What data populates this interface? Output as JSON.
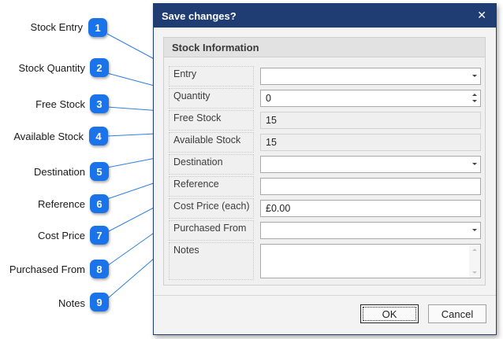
{
  "callouts": [
    {
      "number": "1",
      "label": "Stock Entry"
    },
    {
      "number": "2",
      "label": "Stock Quantity"
    },
    {
      "number": "3",
      "label": "Free Stock"
    },
    {
      "number": "4",
      "label": "Available Stock"
    },
    {
      "number": "5",
      "label": "Destination"
    },
    {
      "number": "6",
      "label": "Reference"
    },
    {
      "number": "7",
      "label": "Cost Price"
    },
    {
      "number": "8",
      "label": "Purchased From"
    },
    {
      "number": "9",
      "label": "Notes"
    }
  ],
  "dialog": {
    "title": "Save changes?",
    "close_icon": "close-icon",
    "accent_color": "#1f3c73",
    "group_title": "Stock Information",
    "fields": {
      "entry": {
        "label": "Entry",
        "value": ""
      },
      "quantity": {
        "label": "Quantity",
        "value": "0"
      },
      "free_stock": {
        "label": "Free Stock",
        "value": "15"
      },
      "available_stock": {
        "label": "Available Stock",
        "value": "15"
      },
      "destination": {
        "label": "Destination",
        "value": ""
      },
      "reference": {
        "label": "Reference",
        "value": ""
      },
      "cost_price": {
        "label": "Cost Price (each)",
        "value": "£0.00"
      },
      "purchased_from": {
        "label": "Purchased From",
        "value": ""
      },
      "notes": {
        "label": "Notes",
        "value": ""
      }
    },
    "buttons": {
      "ok": "OK",
      "cancel": "Cancel"
    }
  },
  "badge_color": "#1a73e8"
}
